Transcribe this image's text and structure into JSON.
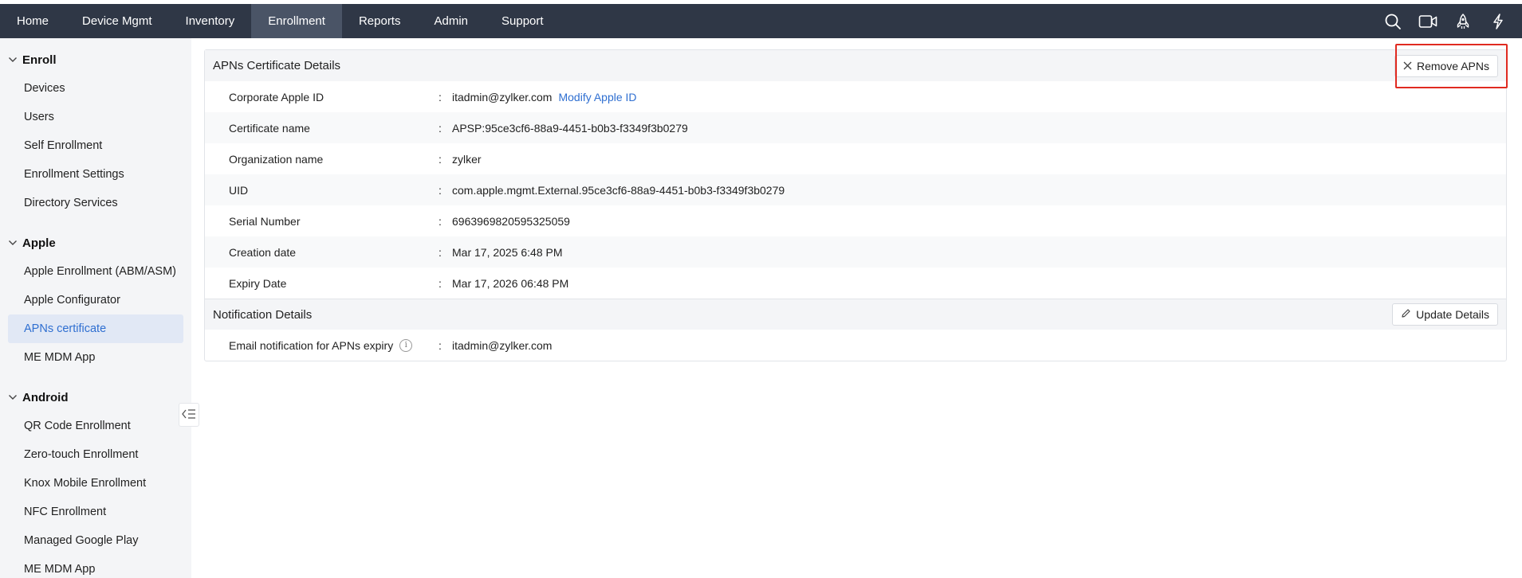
{
  "topnav": {
    "items": [
      {
        "label": "Home"
      },
      {
        "label": "Device Mgmt"
      },
      {
        "label": "Inventory"
      },
      {
        "label": "Enrollment"
      },
      {
        "label": "Reports"
      },
      {
        "label": "Admin"
      },
      {
        "label": "Support"
      }
    ],
    "active_index": 3,
    "icons": [
      "search-icon",
      "video-icon",
      "rocket-icon",
      "lightning-icon"
    ]
  },
  "sidebar": {
    "groups": [
      {
        "title": "Enroll",
        "items": [
          "Devices",
          "Users",
          "Self Enrollment",
          "Enrollment Settings",
          "Directory Services"
        ]
      },
      {
        "title": "Apple",
        "items": [
          "Apple Enrollment (ABM/ASM)",
          "Apple Configurator",
          "APNs certificate",
          "ME MDM App"
        ]
      },
      {
        "title": "Android",
        "items": [
          "QR Code Enrollment",
          "Zero-touch Enrollment",
          "Knox Mobile Enrollment",
          "NFC Enrollment",
          "Managed Google Play",
          "ME MDM App"
        ]
      }
    ],
    "active_item": "APNs certificate"
  },
  "apns": {
    "title": "APNs Certificate Details",
    "remove_label": "Remove APNs",
    "rows": [
      {
        "label": "Corporate Apple ID",
        "value": "itadmin@zylker.com",
        "link": "Modify Apple ID"
      },
      {
        "label": "Certificate name",
        "value": "APSP:95ce3cf6-88a9-4451-b0b3-f3349f3b0279"
      },
      {
        "label": "Organization name",
        "value": "zylker"
      },
      {
        "label": "UID",
        "value": "com.apple.mgmt.External.95ce3cf6-88a9-4451-b0b3-f3349f3b0279"
      },
      {
        "label": "Serial Number",
        "value": "6963969820595325059"
      },
      {
        "label": "Creation date",
        "value": "Mar 17, 2025 6:48 PM"
      },
      {
        "label": "Expiry Date",
        "value": "Mar 17, 2026 06:48 PM"
      }
    ],
    "separator": ":"
  },
  "notification": {
    "title": "Notification Details",
    "update_label": "Update Details",
    "rows": [
      {
        "label": "Email notification for APNs expiry",
        "value": "itadmin@zylker.com",
        "info_icon": "i"
      }
    ]
  },
  "colors": {
    "nav_bg": "#2f3746",
    "nav_active": "#4a5466",
    "link": "#2f6fd1",
    "highlight": "#e02a20"
  }
}
